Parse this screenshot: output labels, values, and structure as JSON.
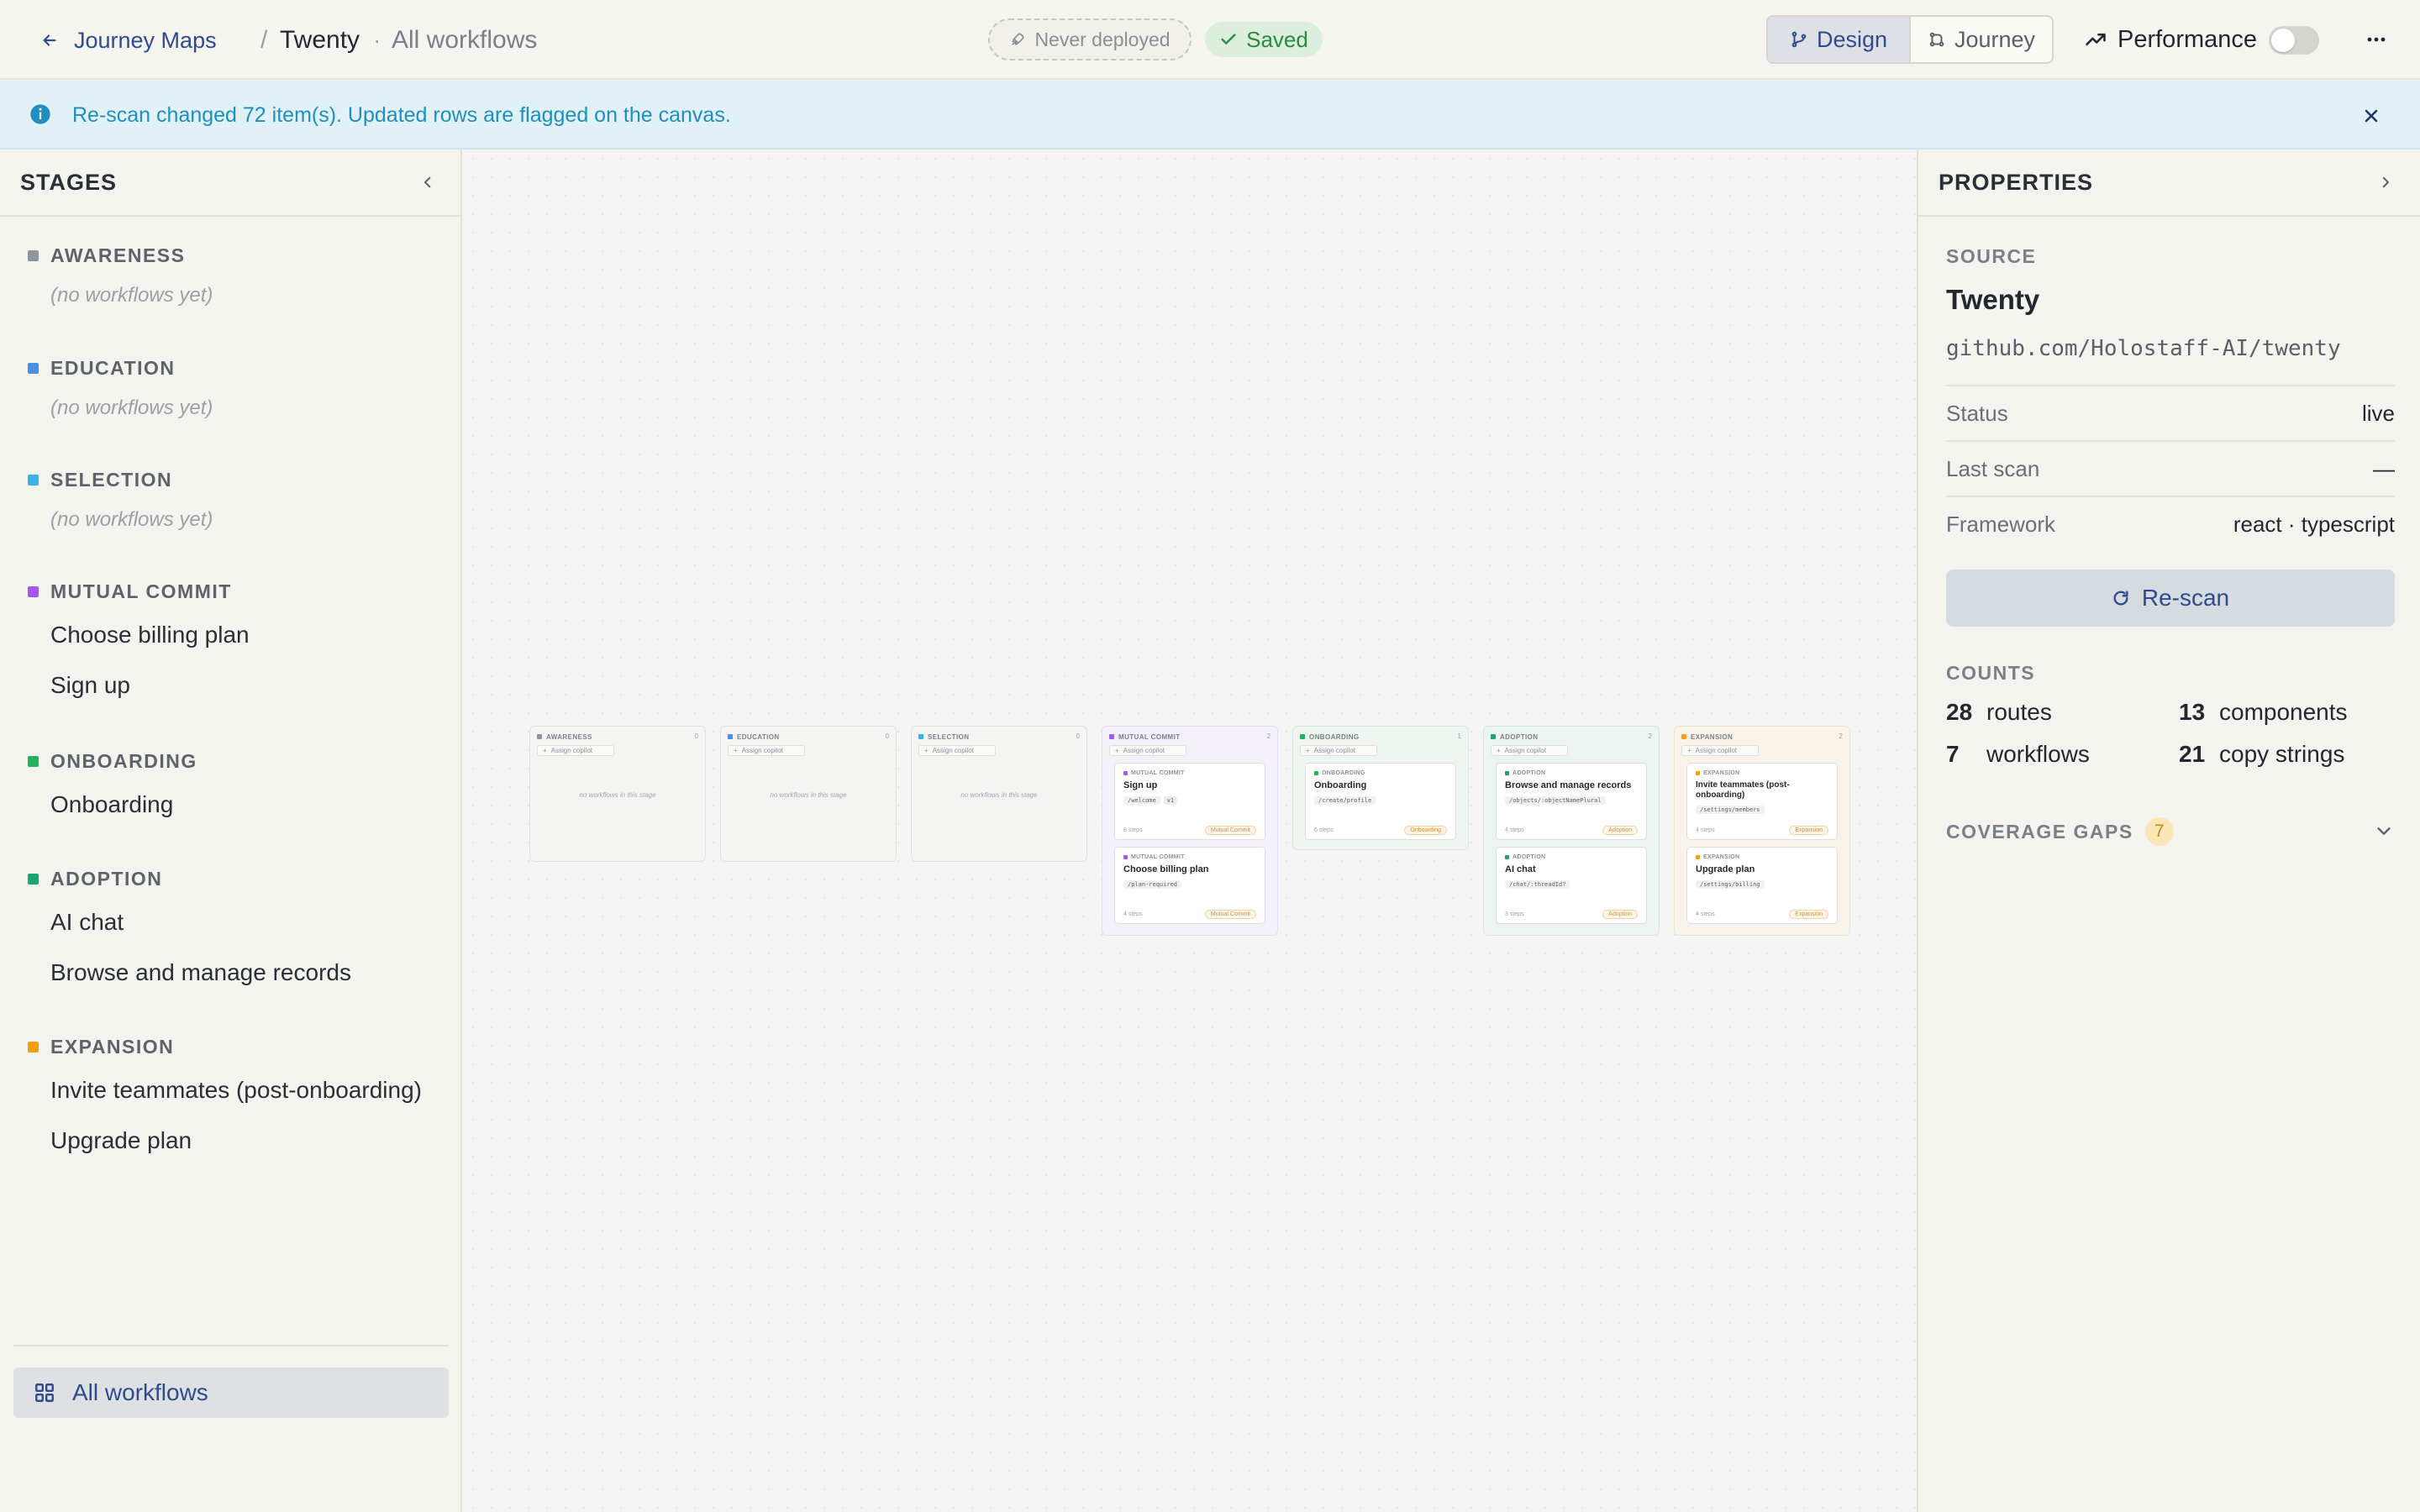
{
  "header": {
    "back_label": "Journey Maps",
    "crumb_separator": "/",
    "project_name": "Twenty",
    "crumb_dot": "·",
    "workflow_crumb": "All workflows",
    "deploy_status": "Never deployed",
    "save_status": "Saved",
    "modes": [
      "Design",
      "Journey"
    ],
    "active_mode": "Design",
    "performance_label": "Performance",
    "performance_enabled": false
  },
  "banner": {
    "text": "Re-scan changed 72 item(s). Updated rows are flagged on the canvas."
  },
  "sidebar": {
    "title": "STAGES",
    "empty_text": "(no workflows yet)",
    "stages": [
      {
        "label": "AWARENESS",
        "color": "#8e96a0",
        "workflows": []
      },
      {
        "label": "EDUCATION",
        "color": "#4a90e2",
        "workflows": []
      },
      {
        "label": "SELECTION",
        "color": "#38b2e8",
        "workflows": []
      },
      {
        "label": "MUTUAL COMMIT",
        "color": "#a855f7",
        "workflows": [
          "Choose billing plan",
          "Sign up"
        ]
      },
      {
        "label": "ONBOARDING",
        "color": "#22b35e",
        "workflows": [
          "Onboarding"
        ]
      },
      {
        "label": "ADOPTION",
        "color": "#18a672",
        "workflows": [
          "AI chat",
          "Browse and manage records"
        ]
      },
      {
        "label": "EXPANSION",
        "color": "#f59e0b",
        "workflows": [
          "Invite teammates (post-onboarding)",
          "Upgrade plan"
        ]
      }
    ],
    "all_workflows_label": "All workflows"
  },
  "canvas": {
    "assign_label": "Assign copilot",
    "empty_text": "no workflows in this stage",
    "columns": [
      {
        "name": "AWARENESS",
        "count": "0",
        "color": "#8e96a0",
        "cards": []
      },
      {
        "name": "EDUCATION",
        "count": "0",
        "color": "#4a90e2",
        "cards": []
      },
      {
        "name": "SELECTION",
        "count": "0",
        "color": "#38b2e8",
        "cards": []
      },
      {
        "name": "MUTUAL COMMIT",
        "count": "2",
        "color": "#a855f7",
        "cards": [
          {
            "title": "Sign up",
            "route": "/welcome",
            "chip": "v1",
            "steps": "8 steps",
            "tag": "Mutual Commit"
          },
          {
            "title": "Choose billing plan",
            "route": "/plan-required",
            "chip": "",
            "steps": "4 steps",
            "tag": "Mutual Commit"
          }
        ]
      },
      {
        "name": "ONBOARDING",
        "count": "1",
        "color": "#22b35e",
        "cards": [
          {
            "title": "Onboarding",
            "route": "/create/profile",
            "chip": "",
            "steps": "6 steps",
            "tag": "Onboarding"
          }
        ]
      },
      {
        "name": "ADOPTION",
        "count": "2",
        "color": "#18a672",
        "cards": [
          {
            "title": "Browse and manage records",
            "route": "/objects/:objectNamePlural",
            "chip": "",
            "steps": "4 steps",
            "tag": "Adoption"
          },
          {
            "title": "AI chat",
            "route": "/chat/:threadId?",
            "chip": "",
            "steps": "3 steps",
            "tag": "Adoption"
          }
        ]
      },
      {
        "name": "EXPANSION",
        "count": "2",
        "color": "#f59e0b",
        "cards": [
          {
            "title": "Invite teammates (post-onboarding)",
            "route": "/settings/members",
            "chip": "",
            "steps": "4 steps",
            "tag": "Expansion"
          },
          {
            "title": "Upgrade plan",
            "route": "/settings/billing",
            "chip": "",
            "steps": "4 steps",
            "tag": "Expansion"
          }
        ]
      }
    ]
  },
  "properties": {
    "title": "PROPERTIES",
    "source_label": "SOURCE",
    "source_name": "Twenty",
    "source_url": "github.com/Holostaff-AI/twenty",
    "rows": [
      {
        "key": "Status",
        "value": "live"
      },
      {
        "key": "Last scan",
        "value": "—"
      },
      {
        "key": "Framework",
        "value": "react · typescript"
      }
    ],
    "rescan_label": "Re-scan",
    "counts_label": "COUNTS",
    "counts": [
      {
        "value": "28",
        "label": "routes"
      },
      {
        "value": "13",
        "label": "components"
      },
      {
        "value": "7",
        "label": "workflows"
      },
      {
        "value": "21",
        "label": "copy strings"
      }
    ],
    "coverage_label": "COVERAGE GAPS",
    "coverage_count": "7"
  }
}
